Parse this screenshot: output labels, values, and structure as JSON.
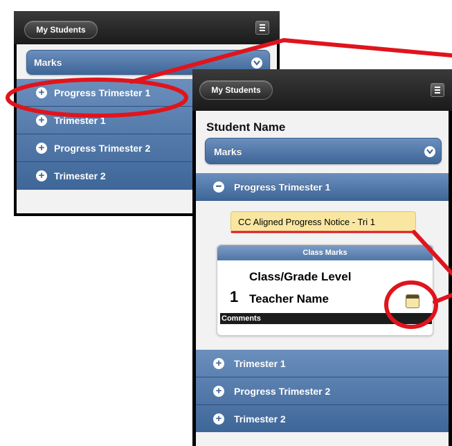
{
  "small_screen": {
    "nav_button": "My Students",
    "marks_label": "Marks",
    "rows": [
      {
        "sign": "+",
        "label": "Progress Trimester 1"
      },
      {
        "sign": "+",
        "label": "Trimester 1"
      },
      {
        "sign": "+",
        "label": "Progress Trimester 2"
      },
      {
        "sign": "+",
        "label": "Trimester 2"
      }
    ]
  },
  "large_screen": {
    "nav_button": "My Students",
    "student_name": "Student Name",
    "marks_label": "Marks",
    "expanded": {
      "sign": "−",
      "label": "Progress Trimester 1"
    },
    "notice": "CC Aligned Progress Notice - Tri 1",
    "class_marks": {
      "header": "Class Marks",
      "period": "1",
      "class_level": "Class/Grade Level",
      "teacher": "Teacher Name",
      "comments_label": "Comments"
    },
    "rows": [
      {
        "sign": "+",
        "label": "Trimester 1"
      },
      {
        "sign": "+",
        "label": "Progress Trimester 2"
      },
      {
        "sign": "+",
        "label": "Trimester 2"
      }
    ]
  },
  "colors": {
    "annotation_red": "#e0141c",
    "bar_blue": "#4a72a4",
    "notice_yellow": "#f9e6a0"
  }
}
